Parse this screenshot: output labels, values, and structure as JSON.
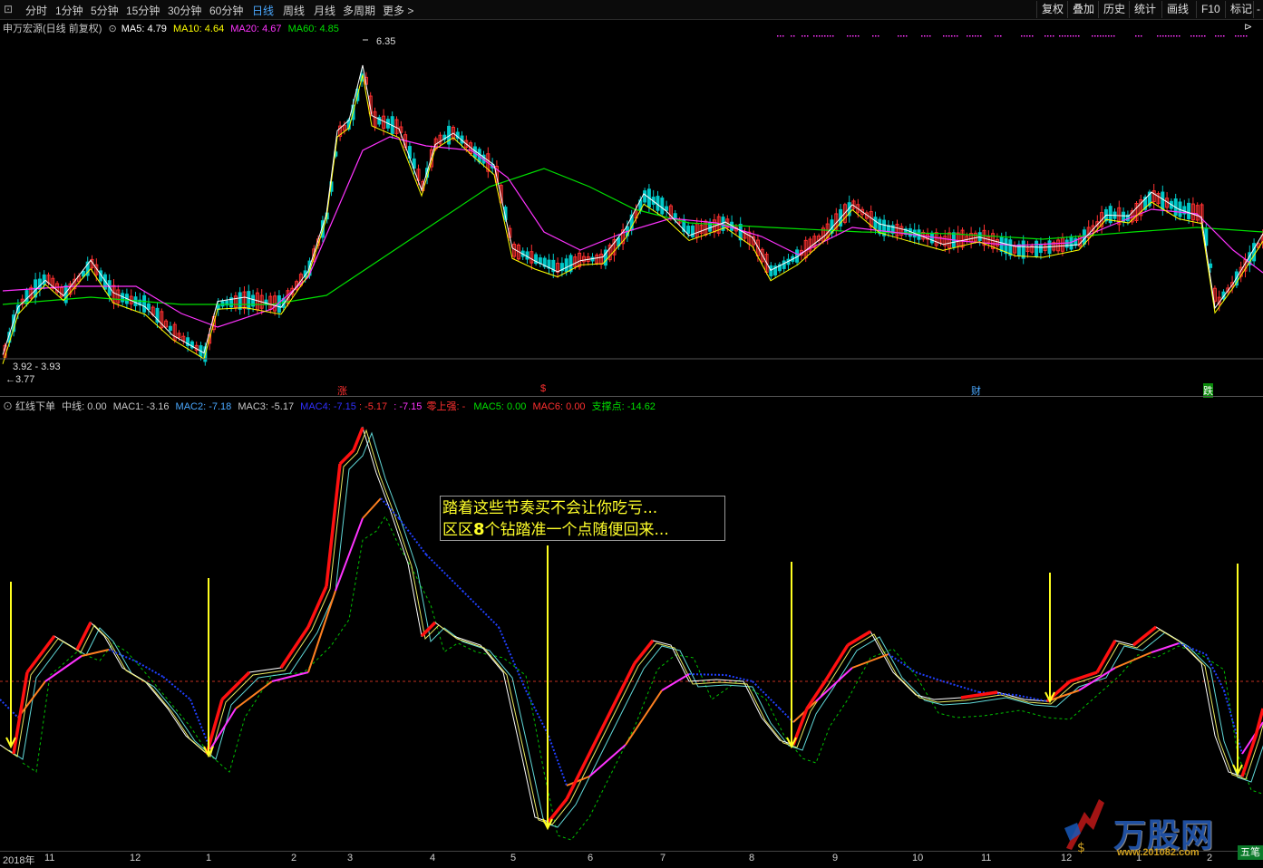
{
  "toolbar": {
    "left_items": [
      "分时",
      "1分钟",
      "5分钟",
      "15分钟",
      "30分钟",
      "60分钟",
      "日线",
      "周线",
      "月线",
      "多周期",
      "更多 >"
    ],
    "active": "日线",
    "right_items": [
      "复权",
      "叠加",
      "历史",
      "统计",
      "画线",
      "F10",
      "标记",
      "-"
    ]
  },
  "main_chart": {
    "stock_title": "申万宏源(日线 前复权)",
    "ma5_label": "MA5: 4.79",
    "ma10_label": "MA10: 4.64",
    "ma20_label": "MA20: 4.67",
    "ma60_label": "MA60: 4.85",
    "high_label": "6.35",
    "low_range_label": "3.92 - 3.93",
    "low_label": "3.77",
    "markers": [
      "涨",
      "$",
      "财",
      "跌"
    ],
    "colors": {
      "ma5": "#ffffff",
      "ma10": "#ffff00",
      "ma20": "#ff33ff",
      "ma60": "#00e000",
      "up": "#ff3030",
      "down": "#00c8c8"
    }
  },
  "indicator": {
    "name": "红线下单",
    "zhongxian": "中线: 0.00",
    "mac1": "MAC1: -3.16",
    "mac2": "MAC2: -7.18",
    "mac3": "MAC3: -5.17",
    "mac4": "MAC4: -7.15",
    "mac4b": ": -5.17",
    "mac4c": ": -7.15",
    "lingshangqiang": "零上强: -",
    "mac5": "MAC5: 0.00",
    "mac6": "MAC6: 0.00",
    "zhichengdian": "支撑点: -14.62"
  },
  "callout": {
    "line1": "踏着这些节奏买不会让你吃亏...",
    "line2_a": "区区",
    "line2_b": "8",
    "line2_c": "个钻踏准一个点随便回来..."
  },
  "time_axis": [
    "2018年",
    "11",
    "12",
    "1",
    "2",
    "3",
    "4",
    "5",
    "6",
    "7",
    "8",
    "9",
    "10",
    "11",
    "12",
    "1",
    "2"
  ],
  "watermark": {
    "brand": "万股网",
    "url": "www.201082.com",
    "corner": "五笔"
  }
}
